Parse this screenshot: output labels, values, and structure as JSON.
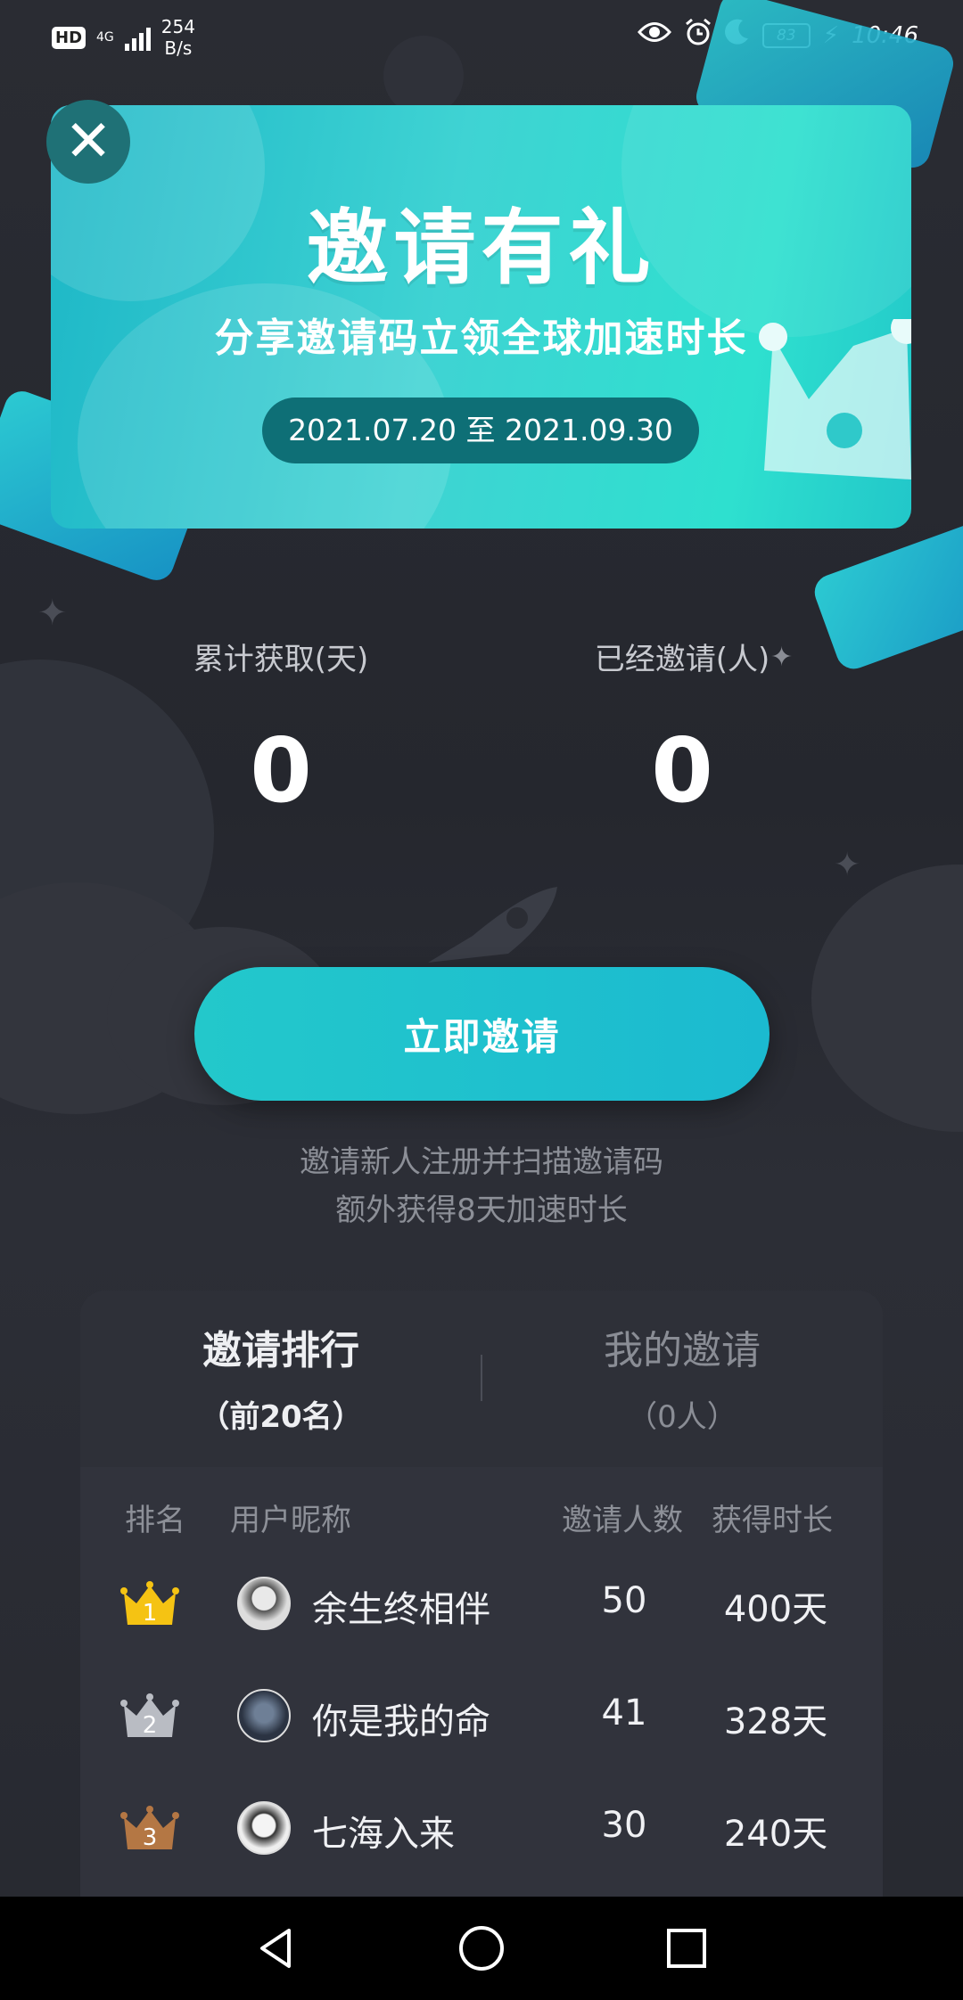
{
  "status_bar": {
    "hd": "HD",
    "network_type": "4G",
    "speed_value": "254",
    "speed_unit": "B/s",
    "battery": "83",
    "time": "10:46"
  },
  "banner": {
    "title": "邀请有礼",
    "subtitle": "分享邀请码立领全球加速时长",
    "date_range": "2021.07.20 至 2021.09.30"
  },
  "stats": {
    "total_label": "累计获取(天)",
    "total_value": "0",
    "invited_label": "已经邀请(人)",
    "invited_value": "0"
  },
  "invite": {
    "button_label": "立即邀请",
    "tip_line1": "邀请新人注册并扫描邀请码",
    "tip_line2": "额外获得8天加速时长"
  },
  "tabs": [
    {
      "label": "邀请排行",
      "sub": "（前20名）",
      "active": true
    },
    {
      "label": "我的邀请",
      "sub": "（0人）",
      "active": false
    }
  ],
  "ranking": {
    "headers": {
      "rank": "排名",
      "nickname": "用户昵称",
      "count": "邀请人数",
      "duration": "获得时长"
    },
    "rows": [
      {
        "rank": "1",
        "nickname": "余生终相伴",
        "count": "50",
        "duration": "400天",
        "crown_color": "#f5c313"
      },
      {
        "rank": "2",
        "nickname": "你是我的命",
        "count": "41",
        "duration": "328天",
        "crown_color": "#b9bcc3"
      },
      {
        "rank": "3",
        "nickname": "七海入来",
        "count": "30",
        "duration": "240天",
        "crown_color": "#b47744"
      }
    ]
  },
  "colors": {
    "accent": "#1fc4cd",
    "background": "#25272e",
    "panel": "#31333c"
  }
}
